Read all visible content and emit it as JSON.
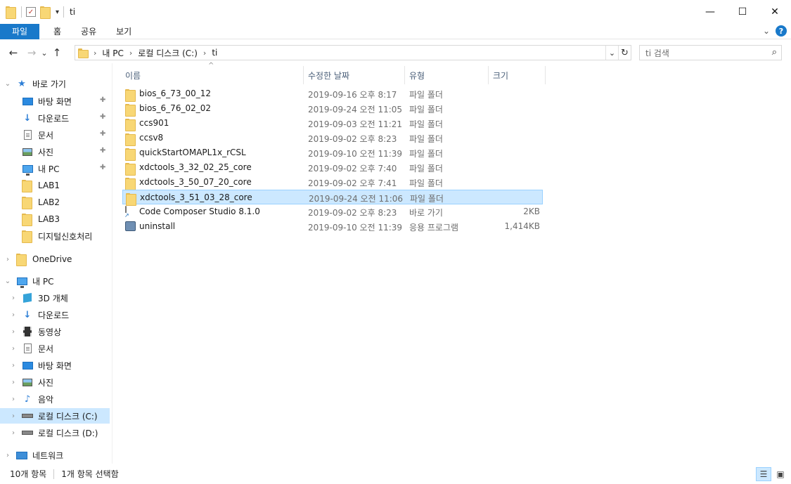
{
  "window": {
    "title": "ti",
    "qat_dropdown_glyph": "▾",
    "buttons": {
      "minimize": "—",
      "maximize": "☐",
      "close": "✕"
    }
  },
  "ribbon": {
    "tabs": [
      "파일",
      "홈",
      "공유",
      "보기"
    ],
    "collapse_glyph": "⌄",
    "help_glyph": "?"
  },
  "nav": {
    "back": "←",
    "forward": "→",
    "recent": "⌄",
    "up": "↑"
  },
  "address": {
    "root_chevron": "›",
    "crumbs": [
      "내 PC",
      "로컬 디스크 (C:)",
      "ti"
    ],
    "dropdown": "⌄",
    "refresh": "↻"
  },
  "search": {
    "placeholder": "ti 검색",
    "icon": "search-icon"
  },
  "navpane": {
    "quick_access": {
      "label": "바로 가기",
      "items": [
        {
          "label": "바탕 화면",
          "icon": "desktop-icon",
          "pinned": true
        },
        {
          "label": "다운로드",
          "icon": "download-icon",
          "pinned": true
        },
        {
          "label": "문서",
          "icon": "documents-icon",
          "pinned": true
        },
        {
          "label": "사진",
          "icon": "pictures-icon",
          "pinned": true
        },
        {
          "label": "내 PC",
          "icon": "pc-icon",
          "pinned": true
        },
        {
          "label": "LAB1",
          "icon": "folder-icon",
          "pinned": false
        },
        {
          "label": "LAB2",
          "icon": "folder-icon",
          "pinned": false
        },
        {
          "label": "LAB3",
          "icon": "folder-icon",
          "pinned": false
        },
        {
          "label": "디지털신호처리",
          "icon": "folder-icon",
          "pinned": false
        }
      ]
    },
    "onedrive": {
      "label": "OneDrive"
    },
    "this_pc": {
      "label": "내 PC",
      "items": [
        {
          "label": "3D 개체",
          "icon": "3d-objects-icon"
        },
        {
          "label": "다운로드",
          "icon": "download-icon"
        },
        {
          "label": "동영상",
          "icon": "videos-icon"
        },
        {
          "label": "문서",
          "icon": "documents-icon"
        },
        {
          "label": "바탕 화면",
          "icon": "desktop-icon"
        },
        {
          "label": "사진",
          "icon": "pictures-icon"
        },
        {
          "label": "음악",
          "icon": "music-icon"
        },
        {
          "label": "로컬 디스크 (C:)",
          "icon": "drive-c-icon",
          "selected": true
        },
        {
          "label": "로컬 디스크 (D:)",
          "icon": "drive-d-icon"
        }
      ]
    },
    "network": {
      "label": "네트워크"
    },
    "expand_glyph": "›",
    "collapse_glyph": "⌄",
    "pin_glyph": "📌"
  },
  "columns": [
    "이름",
    "수정한 날짜",
    "유형",
    "크기"
  ],
  "sort_glyph": "^",
  "files": [
    {
      "name": "bios_6_73_00_12",
      "date": "2019-09-16 오후 8:17",
      "type": "파일 폴더",
      "size": "",
      "icon": "folder-icon"
    },
    {
      "name": "bios_6_76_02_02",
      "date": "2019-09-24 오전 11:05",
      "type": "파일 폴더",
      "size": "",
      "icon": "folder-icon"
    },
    {
      "name": "ccs901",
      "date": "2019-09-03 오전 11:21",
      "type": "파일 폴더",
      "size": "",
      "icon": "folder-icon"
    },
    {
      "name": "ccsv8",
      "date": "2019-09-02 오후 8:23",
      "type": "파일 폴더",
      "size": "",
      "icon": "folder-icon"
    },
    {
      "name": "quickStartOMAPL1x_rCSL",
      "date": "2019-09-10 오전 11:39",
      "type": "파일 폴더",
      "size": "",
      "icon": "folder-icon"
    },
    {
      "name": "xdctools_3_32_02_25_core",
      "date": "2019-09-02 오후 7:40",
      "type": "파일 폴더",
      "size": "",
      "icon": "folder-icon"
    },
    {
      "name": "xdctools_3_50_07_20_core",
      "date": "2019-09-02 오후 7:41",
      "type": "파일 폴더",
      "size": "",
      "icon": "folder-icon"
    },
    {
      "name": "xdctools_3_51_03_28_core",
      "date": "2019-09-24 오전 11:06",
      "type": "파일 폴더",
      "size": "",
      "icon": "folder-icon",
      "selected": true
    },
    {
      "name": "Code Composer Studio 8.1.0",
      "date": "2019-09-02 오후 8:23",
      "type": "바로 가기",
      "size": "2KB",
      "icon": "shortcut-icon"
    },
    {
      "name": "uninstall",
      "date": "2019-09-10 오전 11:39",
      "type": "응용 프로그램",
      "size": "1,414KB",
      "icon": "application-icon"
    }
  ],
  "status": {
    "item_count": "10개 항목",
    "selected_count": "1개 항목 선택함"
  },
  "colors": {
    "accent": "#1979ca",
    "selection_bg": "#cce8ff",
    "selection_border": "#99d1ff",
    "folder": "#f8d775"
  }
}
